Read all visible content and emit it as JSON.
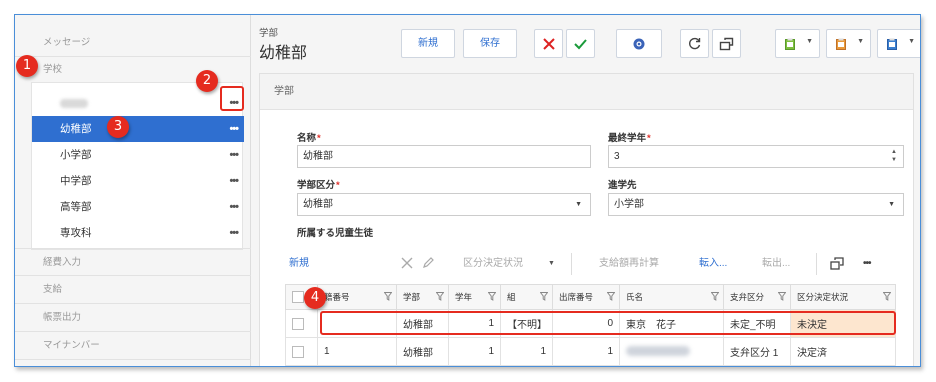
{
  "sidebar": {
    "sections": [
      "メッセージ",
      "学校",
      "経費入力",
      "支給",
      "帳票出力",
      "マイナンバー"
    ],
    "school_placeholder_label": "",
    "items": [
      {
        "label": "幼稚部",
        "active": true
      },
      {
        "label": "小学部",
        "active": false
      },
      {
        "label": "中学部",
        "active": false
      },
      {
        "label": "高等部",
        "active": false
      },
      {
        "label": "専攻科",
        "active": false
      }
    ],
    "more_glyph": "•••"
  },
  "header": {
    "breadcrumb": "学部",
    "title": "幼稚部",
    "buttons": {
      "new": "新規",
      "save": "保存"
    }
  },
  "panel": {
    "title": "学部",
    "fields": {
      "name_label": "名称",
      "name_value": "幼稚部",
      "last_grade_label": "最終学年",
      "last_grade_value": "3",
      "division_label": "学部区分",
      "division_value": "幼稚部",
      "next_label": "進学先",
      "next_value": "小学部",
      "students_label": "所属する児童生徒",
      "required_mark": "*"
    },
    "grid_toolbar": {
      "new": "新規",
      "status": "区分決定状況",
      "recalc": "支給額再計算",
      "transfer_in": "転入...",
      "transfer_out": "転出..."
    },
    "grid": {
      "columns": [
        "籍番号",
        "学部",
        "学年",
        "組",
        "出席番号",
        "氏名",
        "支弁区分",
        "区分決定状況"
      ],
      "rows": [
        {
          "id": "",
          "dept": "幼稚部",
          "grade": "1",
          "class": "【不明】",
          "attend": "0",
          "name": "東京　花子",
          "support": "未定_不明",
          "status": "未決定"
        },
        {
          "id": "1",
          "dept": "幼稚部",
          "grade": "1",
          "class": "1",
          "attend": "1",
          "name": "",
          "support": "支弁区分 1",
          "status": "決定済"
        }
      ]
    }
  },
  "annotations": [
    "1",
    "2",
    "3",
    "4"
  ],
  "colors": {
    "accent": "#2f6fd0",
    "annotation": "#e52b1f",
    "highlight": "#fde6cf"
  }
}
